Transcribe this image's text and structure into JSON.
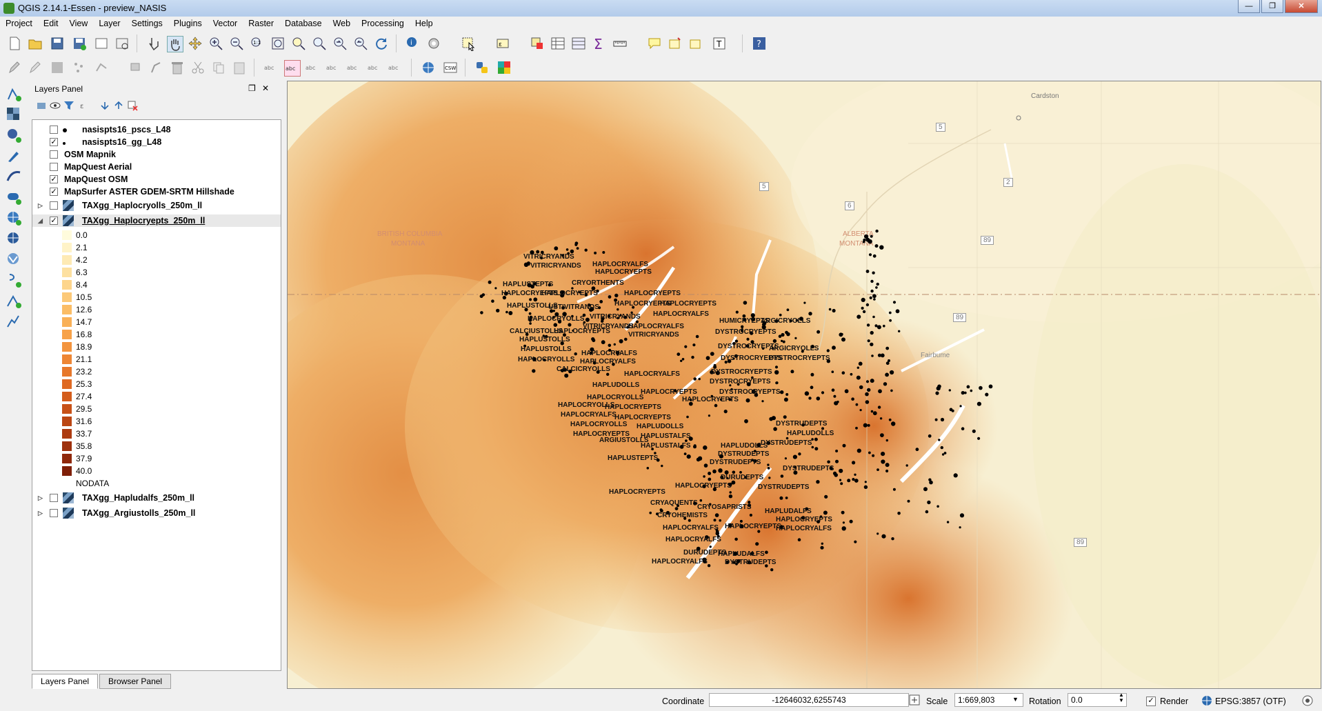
{
  "window": {
    "title": "QGIS 2.14.1-Essen - preview_NASIS",
    "minimize": "—",
    "maximize": "❐",
    "close": "✕"
  },
  "menu": [
    "Project",
    "Edit",
    "View",
    "Layer",
    "Settings",
    "Plugins",
    "Vector",
    "Raster",
    "Database",
    "Web",
    "Processing",
    "Help"
  ],
  "layers_panel": {
    "title": "Layers Panel",
    "layers": [
      {
        "name": "nasispts16_pscs_L48",
        "checked": false,
        "symbol": "dot"
      },
      {
        "name": "nasispts16_gg_L48",
        "checked": true,
        "symbol": "small-dot"
      },
      {
        "name": "OSM Mapnik",
        "checked": false
      },
      {
        "name": "MapQuest Aerial",
        "checked": false
      },
      {
        "name": "MapQuest OSM",
        "checked": true
      },
      {
        "name": "MapSurfer ASTER GDEM-SRTM Hillshade",
        "checked": true
      },
      {
        "name": "TAXgg_Haplocryolls_250m_ll",
        "checked": false,
        "raster": true
      },
      {
        "name": "TAXgg_Haplocryepts_250m_ll",
        "checked": true,
        "raster": true,
        "selected": true
      }
    ],
    "legend": [
      {
        "label": "0.0",
        "color": "#fffbdc"
      },
      {
        "label": "2.1",
        "color": "#fff3c8"
      },
      {
        "label": "4.2",
        "color": "#feeab4"
      },
      {
        "label": "6.3",
        "color": "#fde0a0"
      },
      {
        "label": "8.4",
        "color": "#fdd58c"
      },
      {
        "label": "10.5",
        "color": "#fcc978"
      },
      {
        "label": "12.6",
        "color": "#fbbd66"
      },
      {
        "label": "14.7",
        "color": "#f9b057"
      },
      {
        "label": "16.8",
        "color": "#f7a24a"
      },
      {
        "label": "18.9",
        "color": "#f3943e"
      },
      {
        "label": "21.1",
        "color": "#ee8634"
      },
      {
        "label": "23.2",
        "color": "#e7782b"
      },
      {
        "label": "25.3",
        "color": "#df6a23"
      },
      {
        "label": "27.4",
        "color": "#d45d1c"
      },
      {
        "label": "29.5",
        "color": "#c85117"
      },
      {
        "label": "31.6",
        "color": "#bb4613"
      },
      {
        "label": "33.7",
        "color": "#ad3b10"
      },
      {
        "label": "35.8",
        "color": "#9e310d"
      },
      {
        "label": "37.9",
        "color": "#8f280b"
      },
      {
        "label": "40.0",
        "color": "#7f1f08"
      }
    ],
    "nodata_label": "NODATA",
    "bottom_layers": [
      {
        "name": "TAXgg_Hapludalfs_250m_ll",
        "checked": false
      },
      {
        "name": "TAXgg_Argiustolls_250m_ll",
        "checked": false
      }
    ]
  },
  "tabs": [
    "Layers Panel",
    "Browser Panel"
  ],
  "map": {
    "places": [
      "Cardston",
      "BRITISH COLUMBIA",
      "MONTANA",
      "ALBERTA",
      "MONTANA",
      "Fairbume"
    ],
    "road_shields": [
      "5",
      "5",
      "6",
      "2",
      "89",
      "89",
      "89"
    ],
    "labels": [
      {
        "t": "VITRICRYANDS"
      },
      {
        "t": "VITRICRYANDS"
      },
      {
        "t": "HAPLOCRYALFS"
      },
      {
        "t": "HAPLOCRYEPTS"
      },
      {
        "t": "HAPLUSTEPTS"
      },
      {
        "t": "CRYORTHENTS"
      },
      {
        "t": "HAPLOCRYEPTS"
      },
      {
        "t": "HAPLOCRYEPTS"
      },
      {
        "t": "HAPLOCRYEPTS"
      },
      {
        "t": "HAPLOCRYEPTS"
      },
      {
        "t": "HAPLOCRYEPTS"
      },
      {
        "t": "HAPLUSTOLLS"
      },
      {
        "t": "USTIVITRANDS"
      },
      {
        "t": "HAPLOCRYOLLS"
      },
      {
        "t": "HAPLOCRYALFS"
      },
      {
        "t": "VITRICRYANDS"
      },
      {
        "t": "VITRICRYANDS"
      },
      {
        "t": "HAPLOCRYALFS"
      },
      {
        "t": "CALCIUSTOLLS"
      },
      {
        "t": "HAPLOCRYEPTS"
      },
      {
        "t": "VITRICRYANDS"
      },
      {
        "t": "HAPLUSTOLLS"
      },
      {
        "t": "HAPLUSTOLLS"
      },
      {
        "t": "HAPLOCRYALFS"
      },
      {
        "t": "HAPLOCRYOLLS"
      },
      {
        "t": "HAPLOCRYALFS"
      },
      {
        "t": "CALCICRYOLLS"
      },
      {
        "t": "HAPLOCRYALFS"
      },
      {
        "t": "HAPLUDOLLS"
      },
      {
        "t": "HUMICRYEPTS"
      },
      {
        "t": "ARGICRYOLLS"
      },
      {
        "t": "DYSTROCRYEPTS"
      },
      {
        "t": "DYSTROCRYEPTS"
      },
      {
        "t": "ARGICRYOLLS"
      },
      {
        "t": "DYSTROCRYEPTS"
      },
      {
        "t": "DYSTROCRYEPTS"
      },
      {
        "t": "DYSTROCRYEPTS"
      },
      {
        "t": "DYSTROCRYEPTS"
      },
      {
        "t": "DYSTROCRYEPTS"
      },
      {
        "t": "HAPLOCRYEPTS"
      },
      {
        "t": "HAPLOCRYEPTS"
      },
      {
        "t": "HAPLOCRYOLLS"
      },
      {
        "t": "HAPLOCRYOLLS"
      },
      {
        "t": "HAPLOCRYEPTS"
      },
      {
        "t": "HAPLOCRYALFS"
      },
      {
        "t": "HAPLOCRYEPTS"
      },
      {
        "t": "HAPLOCRYOLLS"
      },
      {
        "t": "HAPLUDOLLS"
      },
      {
        "t": "HAPLOCRYEPTS"
      },
      {
        "t": "HAPLUSTALFS"
      },
      {
        "t": "ARGIUSTOLLS"
      },
      {
        "t": "HAPLUSTALFS"
      },
      {
        "t": "HAPLUSTEPTS"
      },
      {
        "t": "DYSTRUDEPTS"
      },
      {
        "t": "HAPLUDOLLS"
      },
      {
        "t": "HAPLUDOLLS"
      },
      {
        "t": "DYSTRUDEPTS"
      },
      {
        "t": "DYSTRUDEPTS"
      },
      {
        "t": "DYSTRUDEPTS"
      },
      {
        "t": "DYSTRUDEPTS"
      },
      {
        "t": "DURUDEPTS"
      },
      {
        "t": "HAPLOCRYEPTS"
      },
      {
        "t": "HAPLOCRYEPTS"
      },
      {
        "t": "DYSTRUDEPTS"
      },
      {
        "t": "CRYAQUENTS"
      },
      {
        "t": "CRYOSAPRISTS"
      },
      {
        "t": "CRYOHEMISTS"
      },
      {
        "t": "HAPLUDALFS"
      },
      {
        "t": "HAPLOCRYALFS"
      },
      {
        "t": "HAPLOCRYEPTS"
      },
      {
        "t": "HAPLOCRYEPTS"
      },
      {
        "t": "HAPLOCRYALFS"
      },
      {
        "t": "HAPLOCRYALFS"
      },
      {
        "t": "DURUDEPTS"
      },
      {
        "t": "HAPLUDALFS"
      },
      {
        "t": "DYSTRUDEPTS"
      },
      {
        "t": "HAPLOCRYALFS"
      }
    ]
  },
  "status": {
    "coordinate_label": "Coordinate",
    "coordinate_value": "-12646032,6255743",
    "scale_label": "Scale",
    "scale_value": "1:669,803",
    "rotation_label": "Rotation",
    "rotation_value": "0.0",
    "render_label": "Render",
    "render_checked": true,
    "crs": "EPSG:3857 (OTF)"
  }
}
